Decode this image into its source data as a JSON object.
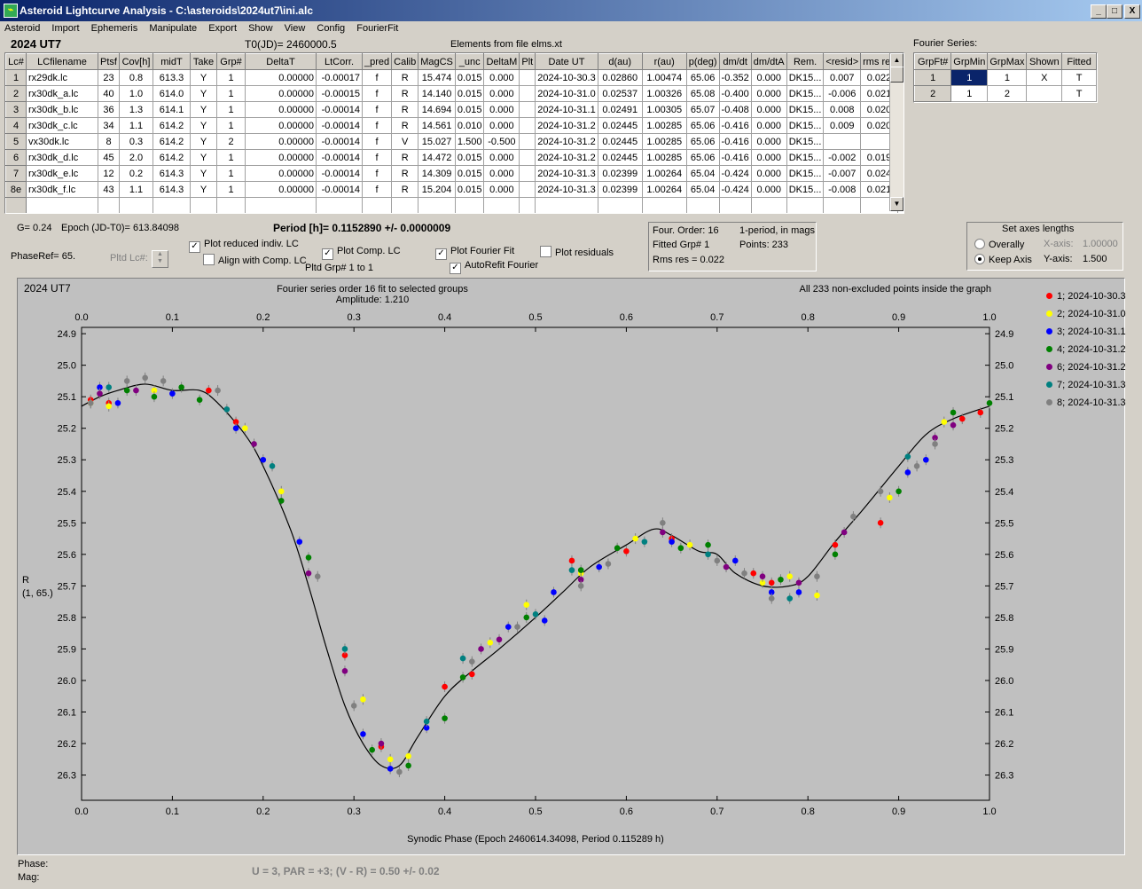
{
  "window": {
    "title": "Asteroid Lightcurve Analysis - C:\\asteroids\\2024ut7\\ini.alc",
    "icon_name": "app-icon",
    "controls": [
      "_",
      "□",
      "X"
    ]
  },
  "menu": [
    "Asteroid",
    "Import",
    "Ephemeris",
    "Manipulate",
    "Export",
    "Show",
    "View",
    "Config",
    "FourierFit"
  ],
  "header": {
    "object": "2024 UT7",
    "t0": "T0(JD)= 2460000.5",
    "elements": "Elements from file elms.xt",
    "fourier_series_label": "Fourier Series:"
  },
  "lc_table": {
    "columns": [
      "Lc#",
      "LCfilename",
      "Ptsf",
      "Cov[h]",
      "midT",
      "Take",
      "Grp#",
      "DeltaT",
      "LtCorr.",
      "_pred",
      "Calib",
      "MagCS",
      "_unc",
      "DeltaM",
      "Plt",
      "Date UT",
      "d(au)",
      "r(au)",
      "p(deg)",
      "dm/dt",
      "dm/dtA",
      "Rem.",
      "<resid>",
      "rms res"
    ],
    "rows": [
      [
        "1",
        "rx29dk.lc",
        "23",
        "0.8",
        "613.3",
        "Y",
        "1",
        "0.00000",
        "-0.00017",
        "f",
        "R",
        "15.474",
        "0.015",
        "0.000",
        "",
        "2024-10-30.3",
        "0.02860",
        "1.00474",
        "65.06",
        "-0.352",
        "0.000",
        "DK15...",
        "0.007",
        "0.022"
      ],
      [
        "2",
        "rx30dk_a.lc",
        "40",
        "1.0",
        "614.0",
        "Y",
        "1",
        "0.00000",
        "-0.00015",
        "f",
        "R",
        "14.140",
        "0.015",
        "0.000",
        "",
        "2024-10-31.0",
        "0.02537",
        "1.00326",
        "65.08",
        "-0.400",
        "0.000",
        "DK15...",
        "-0.006",
        "0.021"
      ],
      [
        "3",
        "rx30dk_b.lc",
        "36",
        "1.3",
        "614.1",
        "Y",
        "1",
        "0.00000",
        "-0.00014",
        "f",
        "R",
        "14.694",
        "0.015",
        "0.000",
        "",
        "2024-10-31.1",
        "0.02491",
        "1.00305",
        "65.07",
        "-0.408",
        "0.000",
        "DK15...",
        "0.008",
        "0.020"
      ],
      [
        "4",
        "rx30dk_c.lc",
        "34",
        "1.1",
        "614.2",
        "Y",
        "1",
        "0.00000",
        "-0.00014",
        "f",
        "R",
        "14.561",
        "0.010",
        "0.000",
        "",
        "2024-10-31.2",
        "0.02445",
        "1.00285",
        "65.06",
        "-0.416",
        "0.000",
        "DK15...",
        "0.009",
        "0.020"
      ],
      [
        "5",
        "vx30dk.lc",
        "8",
        "0.3",
        "614.2",
        "Y",
        "2",
        "0.00000",
        "-0.00014",
        "f",
        "V",
        "15.027",
        "1.500",
        "-0.500",
        "",
        "2024-10-31.2",
        "0.02445",
        "1.00285",
        "65.06",
        "-0.416",
        "0.000",
        "DK15...",
        "",
        ""
      ],
      [
        "6",
        "rx30dk_d.lc",
        "45",
        "2.0",
        "614.2",
        "Y",
        "1",
        "0.00000",
        "-0.00014",
        "f",
        "R",
        "14.472",
        "0.015",
        "0.000",
        "",
        "2024-10-31.2",
        "0.02445",
        "1.00285",
        "65.06",
        "-0.416",
        "0.000",
        "DK15...",
        "-0.002",
        "0.019"
      ],
      [
        "7",
        "rx30dk_e.lc",
        "12",
        "0.2",
        "614.3",
        "Y",
        "1",
        "0.00000",
        "-0.00014",
        "f",
        "R",
        "14.309",
        "0.015",
        "0.000",
        "",
        "2024-10-31.3",
        "0.02399",
        "1.00264",
        "65.04",
        "-0.424",
        "0.000",
        "DK15...",
        "-0.007",
        "0.024"
      ],
      [
        "8e",
        "rx30dk_f.lc",
        "43",
        "1.1",
        "614.3",
        "Y",
        "1",
        "0.00000",
        "-0.00014",
        "f",
        "R",
        "15.204",
        "0.015",
        "0.000",
        "",
        "2024-10-31.3",
        "0.02399",
        "1.00264",
        "65.04",
        "-0.424",
        "0.000",
        "DK15...",
        "-0.008",
        "0.021"
      ]
    ]
  },
  "fourier_table": {
    "columns": [
      "GrpFt#",
      "GrpMin",
      "GrpMax",
      "Shown",
      "Fitted"
    ],
    "rows": [
      [
        "1",
        "1",
        "1",
        "X",
        "T"
      ],
      [
        "2",
        "1",
        "2",
        "",
        "T"
      ]
    ]
  },
  "controls": {
    "g_value": "G= 0.24",
    "epoch": "Epoch (JD-T0)= 613.84098",
    "period": "Period [h]= 0.1152890 +/- 0.0000009",
    "phase_ref": "PhaseRef= 65.",
    "pltd_lc": "Pltd Lc#:",
    "plot_reduced": "Plot reduced indiv. LC",
    "align_comp": "Align with Comp. LC",
    "plot_comp": "Plot Comp. LC",
    "pltd_grp": "Pltd Grp#  1  to  1",
    "plot_fourier": "Plot Fourier Fit",
    "autorefit": "AutoRefit Fourier",
    "plot_residuals": "Plot residuals",
    "four_order": "Four. Order: 16",
    "period_mode": "1-period, in mags",
    "fitted_grp": "Fitted Grp# 1",
    "points": "Points: 233",
    "rms_res": "Rms res     = 0.022",
    "axes_title": "Set axes lengths",
    "overally": "Overally",
    "keep_axis": "Keep Axis",
    "x_axis_label": "X-axis:",
    "x_axis_value": "1.00000",
    "y_axis_label": "Y-axis:",
    "y_axis_value": "1.500",
    "check_mark": "✓"
  },
  "footer": {
    "phase": "Phase:",
    "mag": "Mag:",
    "summary": "U = 3, PAR = +3; (V - R) = 0.50 +/- 0.02"
  },
  "chart_data": {
    "type": "scatter",
    "title": "Fourier series order 16 fit to selected groups",
    "subtitle": "Amplitude: 1.210",
    "corner_left": "2024 UT7",
    "corner_right": "All 233 non-excluded points inside the graph",
    "xlabel": "Synodic Phase (Epoch 2460614.34098, Period 0.115289 h)",
    "ylabel": "R",
    "ylabel2": "(1, 65.)",
    "xlim": [
      0.0,
      1.0
    ],
    "ylim": [
      24.88,
      26.38
    ],
    "y_inverted": true,
    "x_ticks": [
      "0.0",
      "0.1",
      "0.2",
      "0.3",
      "0.4",
      "0.5",
      "0.6",
      "0.7",
      "0.8",
      "0.9",
      "1.0"
    ],
    "y_ticks": [
      "24.9",
      "25.0",
      "25.1",
      "25.2",
      "25.3",
      "25.4",
      "25.5",
      "25.6",
      "25.7",
      "25.8",
      "25.9",
      "26.0",
      "26.1",
      "26.2",
      "26.3"
    ],
    "legend_position": "right",
    "fit_curve": {
      "x": [
        0.0,
        0.02,
        0.04,
        0.07,
        0.1,
        0.13,
        0.15,
        0.18,
        0.2,
        0.23,
        0.25,
        0.27,
        0.29,
        0.31,
        0.33,
        0.35,
        0.37,
        0.4,
        0.43,
        0.46,
        0.5,
        0.53,
        0.56,
        0.6,
        0.63,
        0.65,
        0.68,
        0.7,
        0.72,
        0.75,
        0.78,
        0.8,
        0.83,
        0.86,
        0.9,
        0.93,
        0.96,
        1.0
      ],
      "y": [
        25.13,
        25.1,
        25.08,
        25.06,
        25.08,
        25.08,
        25.12,
        25.22,
        25.32,
        25.52,
        25.7,
        25.9,
        26.08,
        26.2,
        26.27,
        26.27,
        26.18,
        26.05,
        25.97,
        25.9,
        25.8,
        25.72,
        25.64,
        25.57,
        25.52,
        25.54,
        25.59,
        25.6,
        25.66,
        25.7,
        25.7,
        25.67,
        25.56,
        25.46,
        25.32,
        25.22,
        25.17,
        25.13
      ]
    },
    "series": [
      {
        "name": "1; 2024-10-30.3",
        "color": "#ff0000",
        "x": [
          0.01,
          0.03,
          0.14,
          0.17,
          0.29,
          0.33,
          0.4,
          0.43,
          0.54,
          0.6,
          0.65,
          0.74,
          0.76,
          0.83,
          0.88,
          0.97,
          0.99
        ],
        "y": [
          25.11,
          25.12,
          25.08,
          25.18,
          25.92,
          26.21,
          26.02,
          25.98,
          25.62,
          25.59,
          25.55,
          25.66,
          25.69,
          25.57,
          25.5,
          25.17,
          25.15
        ]
      },
      {
        "name": "2; 2024-10-31.0",
        "color": "#ffff00",
        "x": [
          0.01,
          0.03,
          0.08,
          0.18,
          0.22,
          0.31,
          0.34,
          0.36,
          0.45,
          0.49,
          0.55,
          0.61,
          0.67,
          0.75,
          0.78,
          0.81,
          0.89,
          0.95
        ],
        "y": [
          25.12,
          25.13,
          25.08,
          25.2,
          25.4,
          26.06,
          26.25,
          26.24,
          25.88,
          25.76,
          25.66,
          25.55,
          25.57,
          25.69,
          25.67,
          25.73,
          25.42,
          25.18
        ]
      },
      {
        "name": "3; 2024-10-31.1",
        "color": "#0000ff",
        "x": [
          0.02,
          0.04,
          0.1,
          0.17,
          0.2,
          0.24,
          0.31,
          0.34,
          0.38,
          0.47,
          0.51,
          0.52,
          0.57,
          0.65,
          0.72,
          0.76,
          0.79,
          0.91,
          0.93
        ],
        "y": [
          25.07,
          25.12,
          25.09,
          25.2,
          25.3,
          25.56,
          26.17,
          26.28,
          26.15,
          25.83,
          25.81,
          25.72,
          25.64,
          25.56,
          25.62,
          25.72,
          25.72,
          25.34,
          25.3
        ]
      },
      {
        "name": "4; 2024-10-31.2",
        "color": "#008000",
        "x": [
          0.05,
          0.08,
          0.11,
          0.13,
          0.22,
          0.25,
          0.32,
          0.36,
          0.4,
          0.42,
          0.49,
          0.55,
          0.59,
          0.66,
          0.69,
          0.77,
          0.83,
          0.9,
          0.96,
          1.0
        ],
        "y": [
          25.08,
          25.1,
          25.07,
          25.11,
          25.43,
          25.61,
          26.22,
          26.27,
          26.12,
          25.99,
          25.8,
          25.65,
          25.58,
          25.58,
          25.57,
          25.68,
          25.6,
          25.4,
          25.15,
          25.12
        ]
      },
      {
        "name": "6; 2024-10-31.2",
        "color": "#800080",
        "x": [
          0.02,
          0.06,
          0.19,
          0.25,
          0.29,
          0.33,
          0.44,
          0.46,
          0.55,
          0.64,
          0.71,
          0.75,
          0.79,
          0.84,
          0.94,
          0.96
        ],
        "y": [
          25.09,
          25.08,
          25.25,
          25.66,
          25.97,
          26.2,
          25.9,
          25.87,
          25.68,
          25.53,
          25.64,
          25.67,
          25.69,
          25.53,
          25.23,
          25.19
        ]
      },
      {
        "name": "7; 2024-10-31.3",
        "color": "#008080",
        "x": [
          0.03,
          0.16,
          0.21,
          0.29,
          0.38,
          0.42,
          0.5,
          0.54,
          0.62,
          0.69,
          0.78,
          0.91
        ],
        "y": [
          25.07,
          25.14,
          25.32,
          25.9,
          26.13,
          25.93,
          25.79,
          25.65,
          25.56,
          25.6,
          25.74,
          25.29
        ]
      },
      {
        "name": "8; 2024-10-31.3",
        "color": "#808080",
        "x": [
          0.01,
          0.05,
          0.07,
          0.09,
          0.15,
          0.26,
          0.3,
          0.35,
          0.43,
          0.48,
          0.55,
          0.58,
          0.64,
          0.7,
          0.73,
          0.76,
          0.81,
          0.85,
          0.88,
          0.92,
          0.94
        ],
        "y": [
          25.12,
          25.05,
          25.04,
          25.05,
          25.08,
          25.67,
          26.08,
          26.29,
          25.94,
          25.83,
          25.7,
          25.63,
          25.5,
          25.62,
          25.66,
          25.74,
          25.67,
          25.48,
          25.4,
          25.32,
          25.25
        ]
      }
    ]
  }
}
